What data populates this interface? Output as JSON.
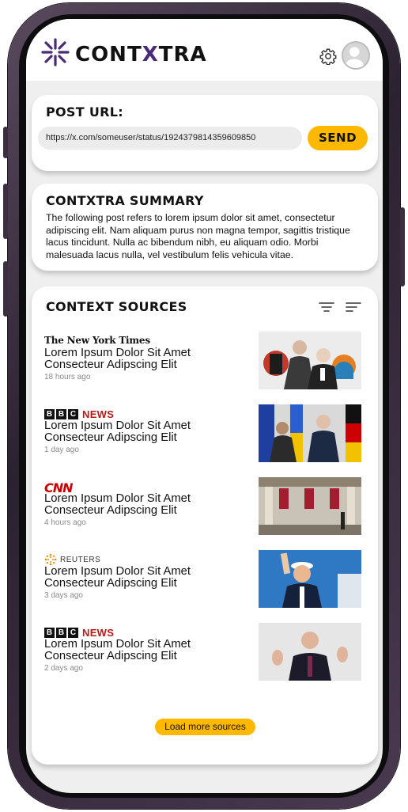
{
  "app": {
    "brand_prefix": "CONTX",
    "brand_x": "",
    "brand_name": "CONTXTRA"
  },
  "header": {
    "logo_text_a": "CONT",
    "logo_text_x": "X",
    "logo_text_b": "TRA"
  },
  "post": {
    "title": "POST URL:",
    "url_value": "https://x.com/someuser/status/1924379814359609850",
    "send_label": "SEND"
  },
  "summary": {
    "title": "CONTXTRA SUMMARY",
    "text": "The following post refers to lorem ipsum dolor sit amet, consectetur adipiscing elit. Nam aliquam purus non magna tempor, sagittis tristique lacus tincidunt. Nulla ac bibendum nibh, eu aliquam odio. Morbi malesuada lacus nulla, vel vestibulum felis vehicula vitae."
  },
  "sources": {
    "title": "CONTEXT SOURCES",
    "items": [
      {
        "outlet": "The New York Times",
        "headline": "Lorem Ipsum Dolor Sit Amet Consecteur Adipscing Elit",
        "time": "18 hours ago"
      },
      {
        "outlet": "NEWS",
        "headline": "Lorem Ipsum Dolor Sit Amet Consecteur Adipscing Elit",
        "time": "1 day ago"
      },
      {
        "outlet": "CNN",
        "headline": "Lorem Ipsum Dolor Sit Amet Consecteur Adipscing Elit",
        "time": "4 hours ago"
      },
      {
        "outlet": "REUTERS",
        "headline": "Lorem Ipsum Dolor Sit Amet Consecteur Adipscing Elit",
        "time": "3 days ago"
      },
      {
        "outlet": "NEWS",
        "headline": "Lorem Ipsum Dolor Sit Amet Consecteur Adipscing Elit",
        "time": "2 days ago"
      }
    ],
    "load_more_label": "Load more sources"
  },
  "bbc_letters": [
    "B",
    "B",
    "C"
  ],
  "colors": {
    "accent": "#ffb800",
    "brand_purple": "#4b2a78",
    "bbc_red": "#bb1919",
    "cnn_red": "#cc0000"
  }
}
